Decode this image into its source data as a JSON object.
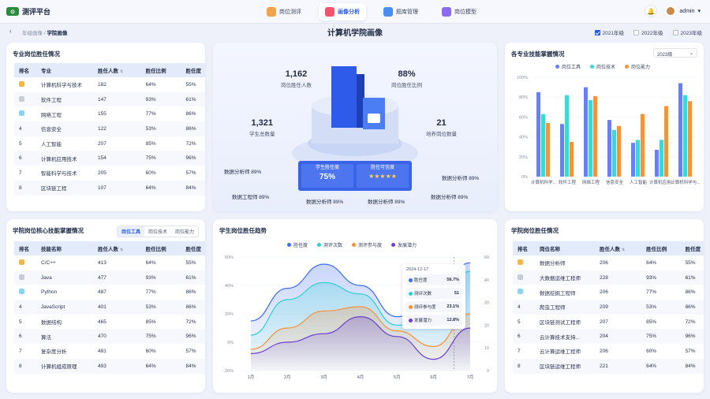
{
  "app": {
    "logo": "测评平台"
  },
  "nav": [
    {
      "label": "岗位测评",
      "color": "#f1a24a"
    },
    {
      "label": "画像分析",
      "color": "#f2546b"
    },
    {
      "label": "题库管理",
      "color": "#4a8ef5"
    },
    {
      "label": "岗位模型",
      "color": "#8a6cf2"
    }
  ],
  "user": {
    "name": "admin"
  },
  "breadcrumb": {
    "parent": "年级画像",
    "sep": "/",
    "current": "学院画像"
  },
  "page_title": "计算机学院画像",
  "years": [
    {
      "label": "2021年级",
      "checked": true
    },
    {
      "label": "2022年级",
      "checked": false
    },
    {
      "label": "2023年级",
      "checked": false
    }
  ],
  "major": {
    "title": "专业岗位胜任情况",
    "headers": [
      "排名",
      "专业",
      "胜任人数",
      "胜任比例",
      "胜任度"
    ],
    "rows": [
      [
        "1",
        "计算机科学与技术",
        "182",
        "64%",
        "55%"
      ],
      [
        "2",
        "软件工程",
        "147",
        "93%",
        "61%"
      ],
      [
        "3",
        "网络工程",
        "155",
        "77%",
        "86%"
      ],
      [
        "4",
        "信息安全",
        "122",
        "53%",
        "86%"
      ],
      [
        "5",
        "人工智能",
        "207",
        "85%",
        "72%"
      ],
      [
        "6",
        "计算机应用技术",
        "154",
        "75%",
        "96%"
      ],
      [
        "7",
        "智能科学与技术",
        "205",
        "60%",
        "57%"
      ],
      [
        "8",
        "区块链工程",
        "107",
        "64%",
        "84%"
      ]
    ]
  },
  "skill": {
    "title": "学院岗位核心技能掌握情况",
    "tabs": [
      "岗位工具",
      "岗位技术",
      "岗位能力"
    ],
    "headers": [
      "排名",
      "技能名称",
      "胜任人数",
      "胜任比例",
      "胜任度"
    ],
    "rows": [
      [
        "1",
        "C/C++",
        "413",
        "64%",
        "55%"
      ],
      [
        "2",
        "Java",
        "477",
        "93%",
        "61%"
      ],
      [
        "3",
        "Python",
        "487",
        "77%",
        "86%"
      ],
      [
        "4",
        "JavaScript",
        "401",
        "53%",
        "86%"
      ],
      [
        "5",
        "数据结构",
        "465",
        "85%",
        "72%"
      ],
      [
        "6",
        "算法",
        "470",
        "75%",
        "96%"
      ],
      [
        "7",
        "复杂度分析",
        "481",
        "60%",
        "57%"
      ],
      [
        "8",
        "计算机组成原理",
        "493",
        "64%",
        "84%"
      ]
    ]
  },
  "post": {
    "title": "学院岗位胜任情况",
    "headers": [
      "排名",
      "岗位名称",
      "胜任人数",
      "胜任比例",
      "胜任度"
    ],
    "rows": [
      [
        "1",
        "数据分析师",
        "206",
        "64%",
        "55%"
      ],
      [
        "2",
        "大数据运维工程师",
        "228",
        "93%",
        "61%"
      ],
      [
        "3",
        "数据挖掘工程师",
        "206",
        "77%",
        "86%"
      ],
      [
        "4",
        "爬虫工程师",
        "209",
        "53%",
        "86%"
      ],
      [
        "5",
        "区块链测试工程师",
        "207",
        "85%",
        "72%"
      ],
      [
        "6",
        "云计算技术支持...",
        "204",
        "75%",
        "96%"
      ],
      [
        "7",
        "云计算运维工程师",
        "206",
        "60%",
        "57%"
      ],
      [
        "8",
        "区块链运维工程师",
        "221",
        "64%",
        "84%"
      ]
    ]
  },
  "center": {
    "stats": [
      {
        "num": "1,162",
        "label": "岗位胜任人数"
      },
      {
        "num": "88%",
        "label": "岗位胜任比例"
      },
      {
        "num": "1,321",
        "label": "学生总数量"
      },
      {
        "num": "21",
        "label": "培养岗位数量"
      }
    ],
    "board": [
      {
        "label": "学生胜任度",
        "value": "75%"
      },
      {
        "label": "胜任可信度",
        "value": "★★★★★"
      }
    ],
    "floats": [
      "数据分析师 89%",
      "数据工程师 89%",
      "数据分析师 89%",
      "数据分析师 89%",
      "数据分析师 89%",
      "数据分析师 89%"
    ]
  },
  "bar_title": "各专业技能掌握情况",
  "bar_select": "2023级",
  "trend_title": "学生岗位胜任趋势",
  "tooltip": {
    "date": "2024-12-17",
    "rows": [
      {
        "name": "胜任度",
        "value": "56.7%",
        "color": "#3d6cf0"
      },
      {
        "name": "测评次数",
        "value": "51",
        "color": "#2fd0cf"
      },
      {
        "name": "测评参与度",
        "value": "23.1%",
        "color": "#f5923e"
      },
      {
        "name": "发展潜力",
        "value": "12.8%",
        "color": "#6b3fd0"
      }
    ]
  },
  "chart_data": [
    {
      "type": "bar",
      "title": "各专业技能掌握情况",
      "categories": [
        "计算机科学...",
        "软件工程",
        "网络工程",
        "信息安全",
        "人工智能",
        "计算机应用...",
        "计算机科学与..."
      ],
      "series": [
        {
          "name": "岗位工具",
          "color": "#6b7ff5",
          "values": [
            85,
            53,
            90,
            57,
            34,
            27,
            94
          ]
        },
        {
          "name": "岗位技术",
          "color": "#3ed8d0",
          "values": [
            63,
            82,
            77,
            47,
            37,
            37,
            82
          ]
        },
        {
          "name": "岗位能力",
          "color": "#f5923e",
          "values": [
            54,
            35,
            81,
            51,
            63,
            71,
            76
          ]
        }
      ],
      "ylim": [
        0,
        100
      ],
      "yticks": [
        "0%",
        "20%",
        "40%",
        "60%",
        "80%",
        "100%"
      ]
    },
    {
      "type": "area",
      "title": "学生岗位胜任趋势",
      "categories": [
        "1月",
        "2月",
        "3月",
        "4月",
        "5月",
        "6月",
        "7月"
      ],
      "series": [
        {
          "name": "胜任度",
          "color": "#3d6cf0",
          "values": [
            15,
            38,
            55,
            40,
            18,
            30,
            56
          ]
        },
        {
          "name": "测评次数",
          "color": "#2fd0cf",
          "values": [
            5,
            30,
            42,
            34,
            12,
            16,
            50
          ]
        },
        {
          "name": "测评参与度",
          "color": "#f5923e",
          "values": [
            -5,
            10,
            22,
            25,
            8,
            -3,
            20
          ]
        },
        {
          "name": "发展潜力",
          "color": "#6b3fd0",
          "values": [
            -8,
            0,
            6,
            18,
            4,
            -12,
            10
          ]
        }
      ],
      "yleft": [
        "60%",
        "40%",
        "20%",
        "0%",
        "-20%"
      ],
      "yright": [
        "50",
        "40",
        "30",
        "20",
        "10",
        "0"
      ],
      "ylim": [
        -20,
        60
      ]
    }
  ]
}
